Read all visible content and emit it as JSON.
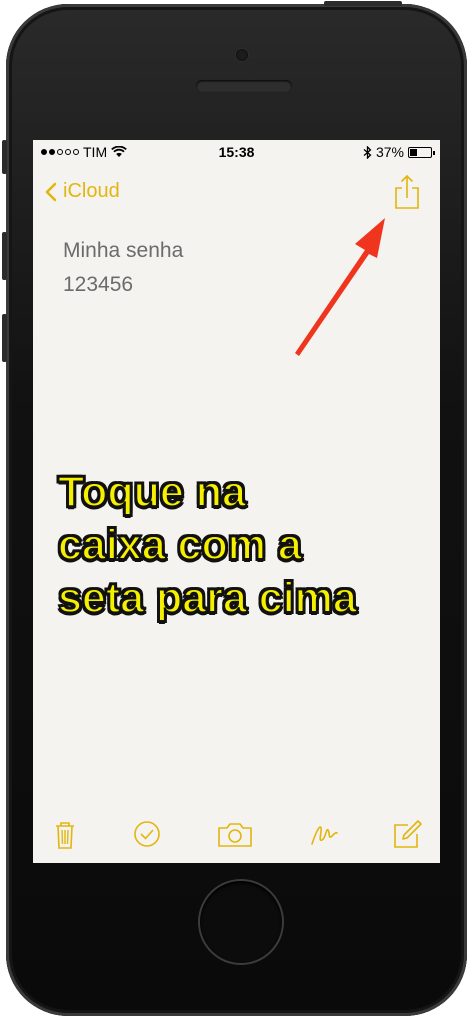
{
  "status": {
    "carrier": "TIM",
    "time": "15:38",
    "battery": "37%",
    "battery_level": 0.37
  },
  "nav": {
    "back_label": "iCloud"
  },
  "note": {
    "line1": "Minha senha",
    "line2": "123456"
  },
  "caption": {
    "line1": "Toque na",
    "line2": "caixa com a",
    "line3": "seta para cima"
  },
  "colors": {
    "accent": "#e2b60f",
    "caption": "#f5ef00",
    "arrow": "#f0351e"
  },
  "icons": [
    "chevron-left-icon",
    "share-icon",
    "trash-icon",
    "checklist-icon",
    "camera-icon",
    "sketch-icon",
    "compose-icon",
    "wifi-icon",
    "bluetooth-icon",
    "battery-icon"
  ]
}
